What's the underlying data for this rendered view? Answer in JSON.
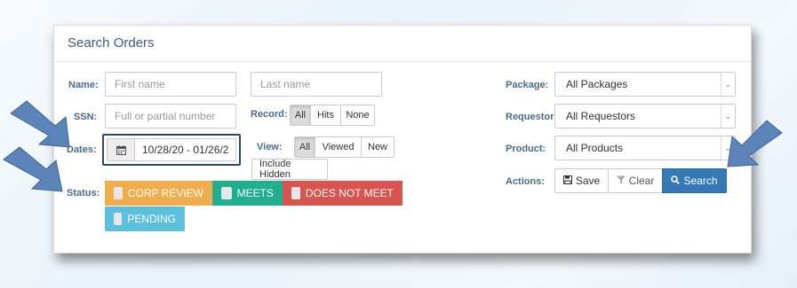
{
  "panel": {
    "title": "Search Orders"
  },
  "labels": {
    "name": "Name:",
    "ssn": "SSN:",
    "dates": "Dates:",
    "status": "Status:",
    "record": "Record:",
    "view": "View:",
    "package": "Package:",
    "requestor": "Requestor:",
    "product": "Product:",
    "actions": "Actions:"
  },
  "fields": {
    "first_name_placeholder": "First name",
    "last_name_placeholder": "Last name",
    "ssn_placeholder": "Full or partial number",
    "date_range": "10/28/20 - 01/26/2"
  },
  "record": {
    "options": [
      "All",
      "Hits",
      "None"
    ],
    "selected": "All"
  },
  "view": {
    "options": [
      "All",
      "Viewed",
      "New"
    ],
    "selected": "All",
    "include_hidden": "Include Hidden"
  },
  "status": [
    {
      "label": "CORP REVIEW",
      "color": "#f0ad4e"
    },
    {
      "label": "MEETS",
      "color": "#1fae8f"
    },
    {
      "label": "DOES NOT MEET",
      "color": "#d9534f"
    },
    {
      "label": "PENDING",
      "color": "#5bc0de"
    }
  ],
  "selects": {
    "package": "All Packages",
    "requestor": "All Requestors",
    "product": "All Products"
  },
  "actions": {
    "save": "Save",
    "clear": "Clear",
    "search": "Search"
  },
  "icons": {
    "calendar": "calendar-icon",
    "save": "floppy-icon",
    "clear": "filter-icon",
    "search": "magnifier-icon"
  },
  "colors": {
    "accent": "#337ab7",
    "arrow": "#5b84b8",
    "highlight_border": "#2c4a70"
  }
}
